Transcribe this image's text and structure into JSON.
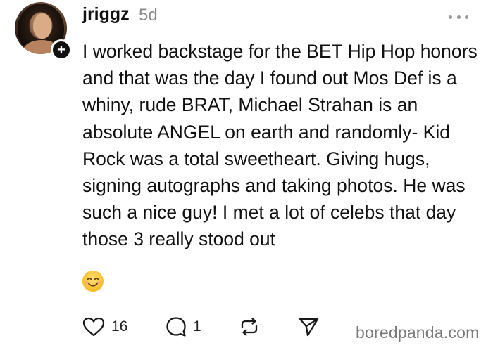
{
  "post": {
    "username": "jriggz",
    "timestamp": "5d",
    "avatar_badge": "+",
    "body": "I worked backstage for the BET Hip Hop honors and that was the day I found out Mos Def is a whiny, rude BRAT, Michael Strahan is an absolute ANGEL on earth and randomly- Kid Rock was a total sweetheart. Giving hugs, signing autographs and taking photos. He was such a nice guy! I met a lot of celebs that day those 3 really stood out",
    "emoji": "smiling-face-emoji"
  },
  "actions": {
    "like_icon": "heart-icon",
    "like_count": "16",
    "comment_icon": "comment-icon",
    "comment_count": "1",
    "repost_icon": "repost-icon",
    "share_icon": "send-icon"
  },
  "watermark": "boredpanda.com",
  "colors": {
    "text": "#111111",
    "muted": "#8a8a8a",
    "background": "#ffffff"
  }
}
